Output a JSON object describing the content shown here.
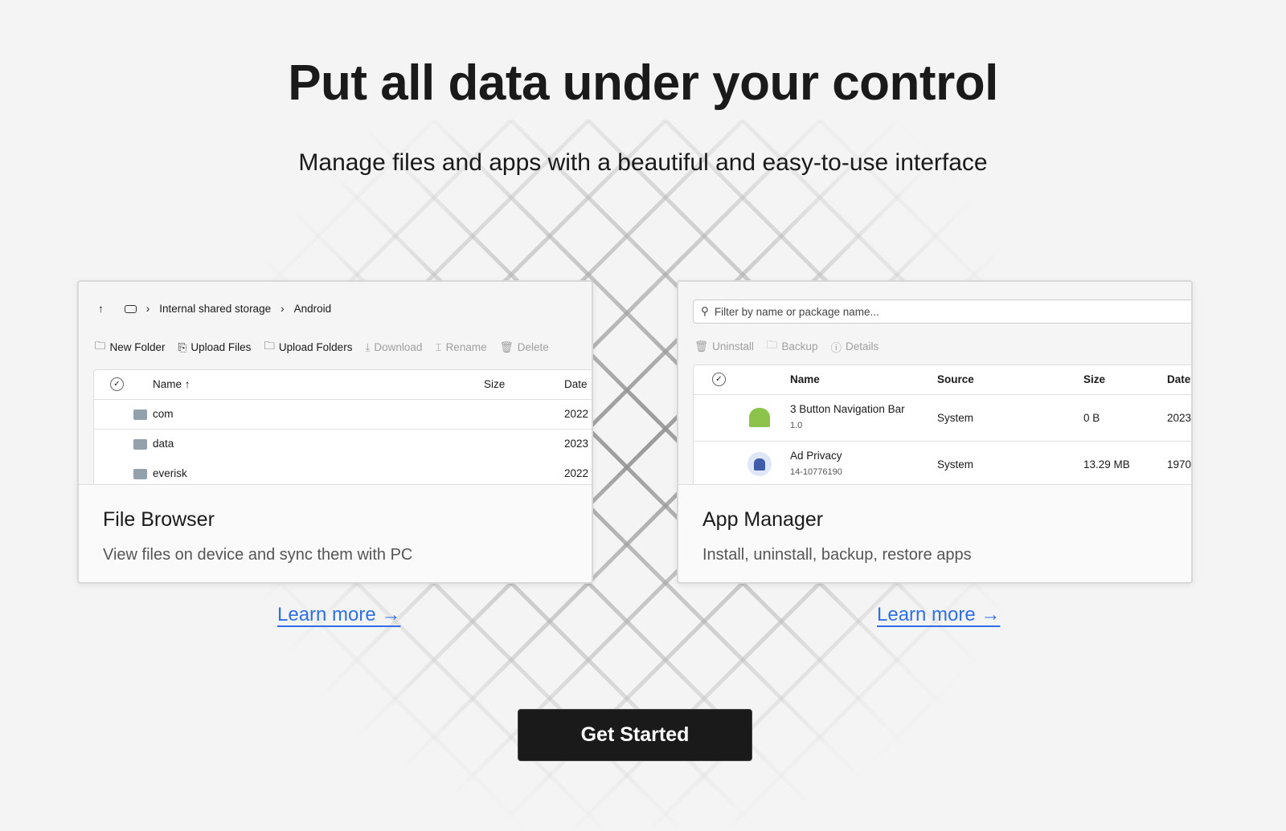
{
  "hero": {
    "title": "Put all data under your control",
    "subtitle": "Manage files and apps with a beautiful and easy-to-use interface"
  },
  "file_browser": {
    "breadcrumb": [
      "Internal shared storage",
      "Android"
    ],
    "toolbar": {
      "new_folder": "New Folder",
      "upload_files": "Upload Files",
      "upload_folders": "Upload Folders",
      "download": "Download",
      "rename": "Rename",
      "delete": "Delete"
    },
    "columns": {
      "name": "Name",
      "sort": "↑",
      "size": "Size",
      "date": "Date"
    },
    "rows": [
      {
        "name": "com",
        "date": "2022"
      },
      {
        "name": "data",
        "date": "2023"
      },
      {
        "name": "everisk",
        "date": "2022"
      }
    ],
    "title": "File Browser",
    "description": "View files on device and sync them with PC",
    "learn_more": "Learn more →"
  },
  "app_manager": {
    "search_placeholder": "Filter by name or package name...",
    "toolbar": {
      "uninstall": "Uninstall",
      "backup": "Backup",
      "details": "Details"
    },
    "columns": {
      "name": "Name",
      "source": "Source",
      "size": "Size",
      "date": "Date"
    },
    "rows": [
      {
        "name": "3 Button Navigation Bar",
        "version": "1.0",
        "source": "System",
        "size": "0 B",
        "date": "2023."
      },
      {
        "name": "Ad Privacy",
        "version": "14-10776190",
        "source": "System",
        "size": "13.29 MB",
        "date": "1970."
      }
    ],
    "title": "App Manager",
    "description": "Install, uninstall, backup, restore apps",
    "learn_more": "Learn more →"
  },
  "cta": {
    "label": "Get Started"
  },
  "colors": {
    "link": "#2f6fe6",
    "button": "#1a1a1a",
    "android_green": "#8cc34a",
    "android_blue": "#3f5ba9"
  }
}
